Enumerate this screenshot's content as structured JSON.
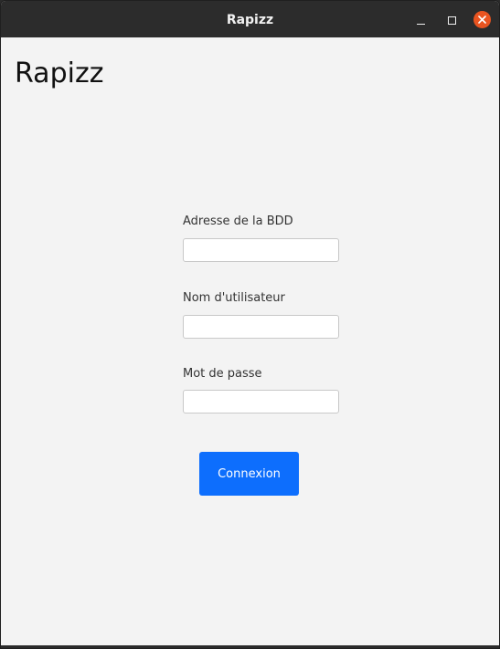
{
  "window": {
    "title": "Rapizz",
    "controls": {
      "minimize": "minimize-icon",
      "maximize": "maximize-icon",
      "close": "close-icon"
    },
    "accent_close_color": "#e95420"
  },
  "app": {
    "heading": "Rapizz"
  },
  "login_form": {
    "db_address": {
      "label": "Adresse de la BDD",
      "value": "",
      "placeholder": ""
    },
    "username": {
      "label": "Nom d'utilisateur",
      "value": "",
      "placeholder": ""
    },
    "password": {
      "label": "Mot de passe",
      "value": "",
      "placeholder": ""
    },
    "submit_label": "Connexion",
    "submit_color": "#0d6efd"
  }
}
